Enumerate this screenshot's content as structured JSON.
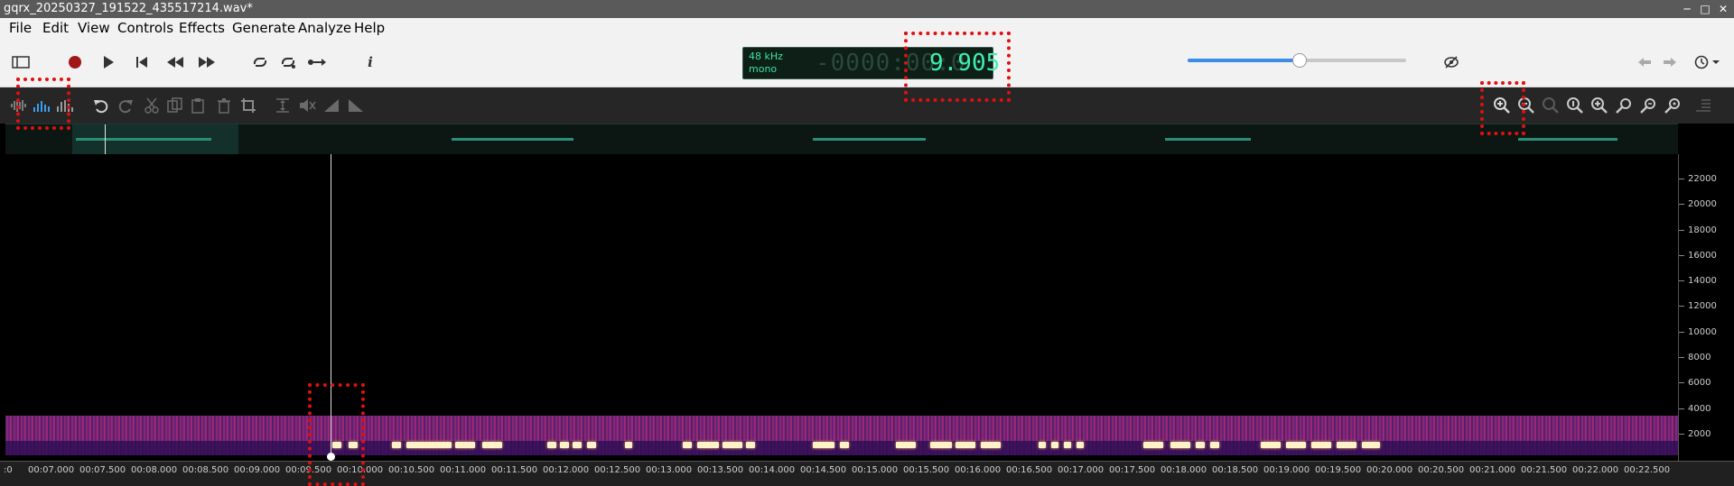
{
  "window": {
    "title": "gqrx_20250327_191522_435517214.wav*",
    "controls": [
      "─",
      "□",
      "✕"
    ]
  },
  "menu": [
    "File",
    "Edit",
    "View",
    "Controls",
    "Effects",
    "Generate",
    "Analyze",
    "Help"
  ],
  "transport": {
    "icons": [
      "sidebar-toggle-icon",
      "record-icon",
      "play-icon",
      "skip-to-start-icon",
      "rewind-icon",
      "fast-forward-icon",
      "loop-icon",
      "loop-add-icon",
      "follow-playhead-icon",
      "info-icon"
    ]
  },
  "lcd": {
    "sample_rate": "48 kHz",
    "channel_mode": "mono",
    "time_ghost": "-0000:00:0",
    "time": "9.905"
  },
  "volume": {
    "level": 0.51
  },
  "toolbar_right": {
    "icons": [
      "eye-icon",
      "back-arrow-icon",
      "forward-arrow-icon",
      "history-icon"
    ]
  },
  "view_modes": [
    "waveform-view-icon",
    "spectrogram-view-icon",
    "combined-view-icon"
  ],
  "edit_tools": [
    "undo-icon",
    "redo-icon",
    "cut-icon",
    "copy-icon",
    "paste-icon",
    "delete-icon",
    "crop-icon",
    "normalize-icon",
    "silence-icon",
    "fade-in-icon",
    "fade-out-icon"
  ],
  "zoom_tools": [
    "zoom-in-icon",
    "zoom-out-icon",
    "zoom-reset-icon",
    "zoom-fit-icon",
    "zoom-selection-icon",
    "zoom-alt-in-icon",
    "zoom-alt-out-icon",
    "zoom-alt-fit-icon",
    "level-meter-icon"
  ],
  "frequency_axis": [
    "22000",
    "20000",
    "18000",
    "16000",
    "14000",
    "12000",
    "10000",
    "8000",
    "6000",
    "4000",
    "2000"
  ],
  "time_axis": [
    ":0",
    "00:07.000",
    "00:07.500",
    "00:08.000",
    "00:08.500",
    "00:09.000",
    "00:09.500",
    "00:10.000",
    "00:10.500",
    "00:11.000",
    "00:11.500",
    "00:12.000",
    "00:12.500",
    "00:13.000",
    "00:13.500",
    "00:14.000",
    "00:14.500",
    "00:15.000",
    "00:15.500",
    "00:16.000",
    "00:16.500",
    "00:17.000",
    "00:17.500",
    "00:18.000",
    "00:18.500",
    "00:19.000",
    "00:19.500",
    "00:20.000",
    "00:20.500",
    "00:21.000",
    "00:21.500",
    "00:22.000",
    "00:22.500"
  ],
  "colors": {
    "lcd_text": "#3ff0b0",
    "highlight": "#e01010",
    "accent": "#3b8ee8"
  }
}
